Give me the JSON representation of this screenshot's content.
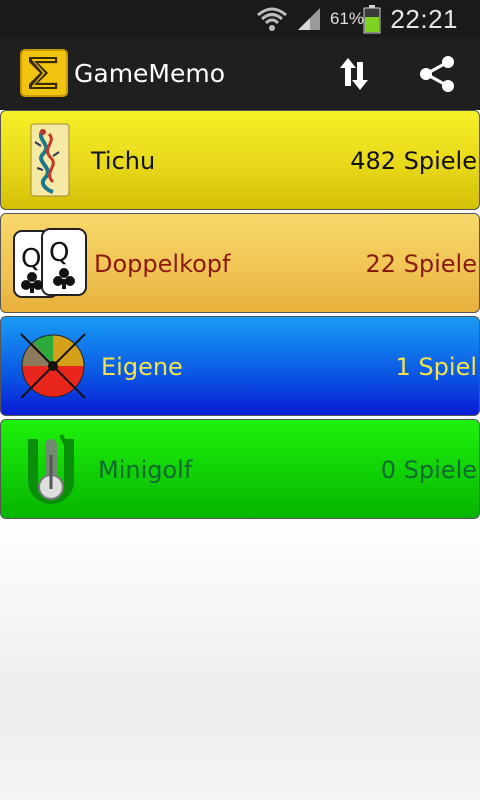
{
  "status_bar": {
    "battery_percent": "61%",
    "time": "22:21",
    "icons": [
      "wifi-icon",
      "signal-icon",
      "battery-icon"
    ],
    "battery_color": "#7ed321"
  },
  "action_bar": {
    "title": "GameMemo",
    "app_icon": "sigma-logo-icon",
    "actions": [
      "sort-arrows-icon",
      "share-icon"
    ],
    "background": "#1f1f1f"
  },
  "games": [
    {
      "name": "Tichu",
      "count": "482 Spiele",
      "icon": "tichu-dragon-card-icon",
      "text_color": "#111111",
      "color": "#e8d81a"
    },
    {
      "name": "Doppelkopf",
      "count": "22 Spiele",
      "icon": "queen-of-clubs-cards-icon",
      "text_color": "#8a1a10",
      "color": "#f0c353"
    },
    {
      "name": "Eigene",
      "count": "1 Spiel",
      "icon": "color-wheel-x-icon",
      "text_color": "#f5e24a",
      "color": "#0a56e3"
    },
    {
      "name": "Minigolf",
      "count": "0 Spiele",
      "icon": "golf-putter-icon",
      "text_color": "#0e6a30",
      "color": "#0fcd04"
    }
  ]
}
